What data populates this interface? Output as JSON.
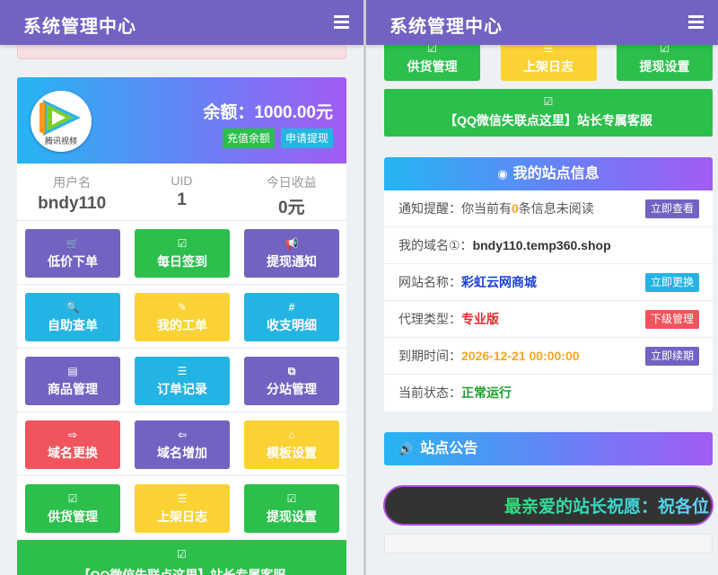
{
  "header": {
    "title": "系统管理中心"
  },
  "profile": {
    "logo_text": "腾讯视频",
    "balance": "余额：1000.00元",
    "recharge_label": "充值余额",
    "withdraw_label": "申请提现"
  },
  "stats": [
    {
      "label": "用户名",
      "value": "bndy110"
    },
    {
      "label": "UID",
      "value": "1"
    },
    {
      "label": "今日收益",
      "value": "0元"
    }
  ],
  "menu": [
    {
      "label": "低价下单",
      "icon": "cart-icon",
      "color": "#7262c2"
    },
    {
      "label": "每日签到",
      "icon": "check-square-icon",
      "color": "#2cbf4c"
    },
    {
      "label": "提现通知",
      "icon": "bullhorn-icon",
      "color": "#7262c2"
    },
    {
      "label": "自助查单",
      "icon": "search-icon",
      "color": "#24b4e3"
    },
    {
      "label": "我的工单",
      "icon": "edit-check-icon",
      "color": "#fbd233"
    },
    {
      "label": "收支明细",
      "icon": "hash-icon",
      "color": "#24b4e3"
    },
    {
      "label": "商品管理",
      "icon": "list-alt-icon",
      "color": "#7262c2"
    },
    {
      "label": "订单记录",
      "icon": "list-icon",
      "color": "#24b4e3"
    },
    {
      "label": "分站管理",
      "icon": "sitemap-icon",
      "color": "#7262c2"
    },
    {
      "label": "域名更换",
      "icon": "sign-out-icon",
      "color": "#f0545c"
    },
    {
      "label": "域名增加",
      "icon": "sign-in-icon",
      "color": "#7262c2"
    },
    {
      "label": "模板设置",
      "icon": "home-icon",
      "color": "#fbd233"
    },
    {
      "label": "供货管理",
      "icon": "check-square-icon",
      "color": "#2cbf4c"
    },
    {
      "label": "上架日志",
      "icon": "list-icon",
      "color": "#fbd233"
    },
    {
      "label": "提现设置",
      "icon": "check-square-icon",
      "color": "#2cbf4c"
    }
  ],
  "service_button": {
    "label": "【QQ微信失联点这里】站长专属客服",
    "icon": "check-square-icon"
  },
  "site_info": {
    "title": "我的站点信息",
    "notice_label": "通知提醒：",
    "notice_pre": "你当前有",
    "notice_count": "0",
    "notice_post": "条信息未阅读",
    "notice_btn": "立即查看",
    "domain_label": "我的域名①：",
    "domain_value": "bndy110.temp360.shop",
    "name_label": "网站名称：",
    "name_value": "彩虹云网商城",
    "name_btn": "立即更换",
    "agent_label": "代理类型：",
    "agent_value": "专业版",
    "agent_btn": "下级管理",
    "expire_label": "到期时间：",
    "expire_value": "2026-12-21 00:00:00",
    "expire_btn": "立即续期",
    "status_label": "当前状态：",
    "status_value": "正常运行"
  },
  "announcement": {
    "title": "站点公告",
    "marquee": "最亲爱的站长祝愿：祝各位"
  },
  "colors": {
    "purple": "#7262c2",
    "green": "#2cbf4c",
    "cyan": "#24b4e3",
    "yellow": "#fbd233",
    "red": "#f0545c",
    "gradient_start": "#25b5f4",
    "gradient_end": "#a25cf2"
  }
}
